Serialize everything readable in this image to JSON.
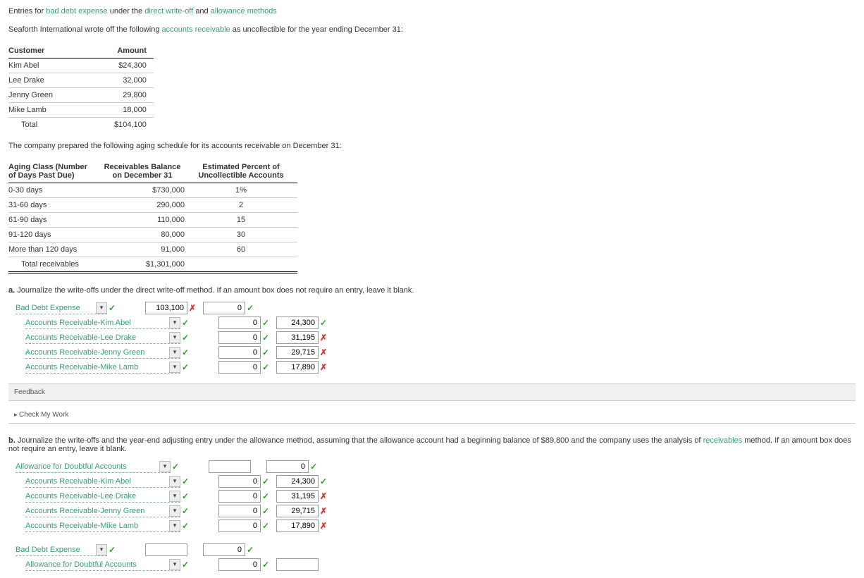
{
  "title": {
    "plain1": "Entries for",
    "link1": "bad debt expense",
    "plain2": "under the",
    "link2": "direct write-off",
    "plain3": "and",
    "link3": "allowance methods"
  },
  "intro": {
    "part1": "Seaforth International wrote off the following",
    "link": "accounts receivable",
    "part2": "as uncollectible for the year ending December 31:"
  },
  "customerTable": {
    "headers": [
      "Customer",
      "Amount"
    ],
    "rows": [
      {
        "name": "Kim Abel",
        "amount": "$24,300"
      },
      {
        "name": "Lee Drake",
        "amount": "32,000"
      },
      {
        "name": "Jenny Green",
        "amount": "29,800"
      },
      {
        "name": "Mike Lamb",
        "amount": "18,000"
      }
    ],
    "totalLabel": "Total",
    "totalAmount": "$104,100"
  },
  "agingIntro": "The company prepared the following aging schedule for its accounts receivable on December 31:",
  "agingTable": {
    "headers": [
      "Aging Class (Number of Days Past Due)",
      "Receivables Balance on December 31",
      "Estimated Percent of Uncollectible Accounts"
    ],
    "rows": [
      {
        "class": "0-30 days",
        "bal": "$730,000",
        "pct": "1%"
      },
      {
        "class": "31-60 days",
        "bal": "290,000",
        "pct": "2"
      },
      {
        "class": "61-90 days",
        "bal": "110,000",
        "pct": "15"
      },
      {
        "class": "91-120 days",
        "bal": "80,000",
        "pct": "30"
      },
      {
        "class": "More than 120 days",
        "bal": "91,000",
        "pct": "60"
      }
    ],
    "totalLabel": "Total receivables",
    "totalBal": "$1,301,000"
  },
  "a": {
    "label": "a.",
    "text": "Journalize the write-offs under the direct write-off method. If an amount box does not require an entry, leave it blank.",
    "rows": [
      {
        "acct": "Bad Debt Expense",
        "indent": false,
        "ddw": "w130",
        "deb": "103,100",
        "debMark": "bad",
        "cred": "0",
        "credMark": "ok"
      },
      {
        "acct": "Accounts Receivable-Kim Abel",
        "indent": true,
        "ddw": "w220",
        "deb": "0",
        "debMark": "ok",
        "cred": "24,300",
        "credMark": "ok"
      },
      {
        "acct": "Accounts Receivable-Lee Drake",
        "indent": true,
        "ddw": "w220",
        "deb": "0",
        "debMark": "ok",
        "cred": "31,195",
        "credMark": "bad"
      },
      {
        "acct": "Accounts Receivable-Jenny Green",
        "indent": true,
        "ddw": "w220",
        "deb": "0",
        "debMark": "ok",
        "cred": "29,715",
        "credMark": "bad"
      },
      {
        "acct": "Accounts Receivable-Mike Lamb",
        "indent": true,
        "ddw": "w220",
        "deb": "0",
        "debMark": "ok",
        "cred": "17,890",
        "credMark": "bad"
      }
    ]
  },
  "feedbackLabel": "Feedback",
  "checkLabel": "Check My Work",
  "b": {
    "label": "b.",
    "text1": "Journalize the write-offs and the year-end adjusting entry under the allowance method, assuming that the allowance account had a beginning balance of $89,800 and the company uses the analysis of",
    "link": "receivables",
    "text2": "method. If an amount box does not require an entry, leave it blank.",
    "rows": [
      {
        "acct": "Allowance for Doubtful Accounts",
        "indent": false,
        "ddw": "w220",
        "deb": "",
        "debMark": "",
        "cred": "0",
        "credMark": "ok"
      },
      {
        "acct": "Accounts Receivable-Kim Abel",
        "indent": true,
        "ddw": "w220",
        "deb": "0",
        "debMark": "ok",
        "cred": "24,300",
        "credMark": "ok"
      },
      {
        "acct": "Accounts Receivable-Lee Drake",
        "indent": true,
        "ddw": "w220",
        "deb": "0",
        "debMark": "ok",
        "cred": "31,195",
        "credMark": "bad"
      },
      {
        "acct": "Accounts Receivable-Jenny Green",
        "indent": true,
        "ddw": "w220",
        "deb": "0",
        "debMark": "ok",
        "cred": "29,715",
        "credMark": "bad"
      },
      {
        "acct": "Accounts Receivable-Mike Lamb",
        "indent": true,
        "ddw": "w220",
        "deb": "0",
        "debMark": "ok",
        "cred": "17,890",
        "credMark": "bad"
      }
    ],
    "rows2": [
      {
        "acct": "Bad Debt Expense",
        "indent": false,
        "ddw": "w130",
        "deb": "",
        "debMark": "",
        "cred": "0",
        "credMark": "ok"
      },
      {
        "acct": "Allowance for Doubtful Accounts",
        "indent": true,
        "ddw": "w220",
        "deb": "0",
        "debMark": "ok",
        "cred": "",
        "credMark": ""
      }
    ]
  }
}
